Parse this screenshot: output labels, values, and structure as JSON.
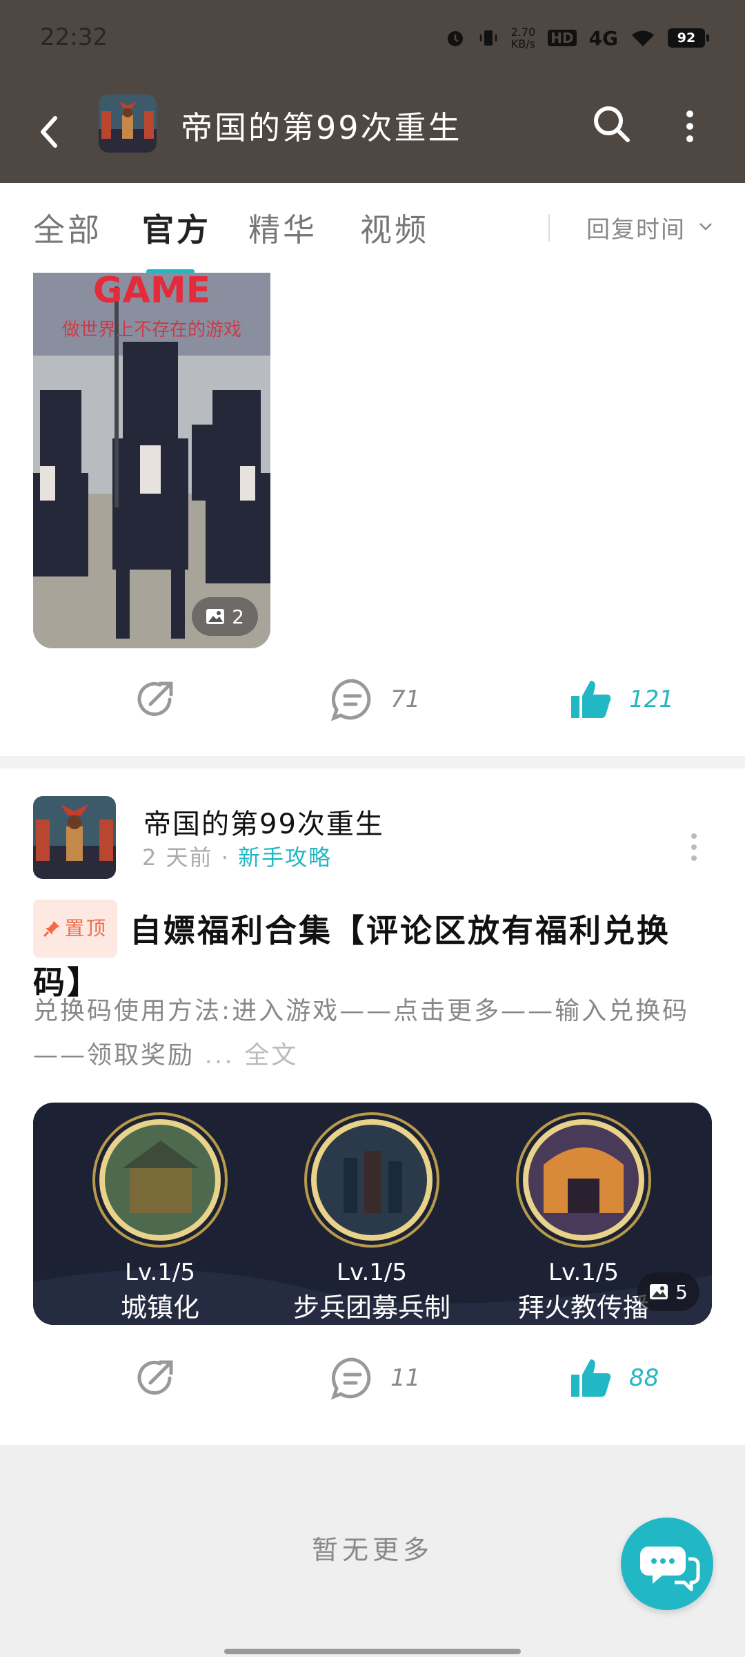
{
  "status_bar": {
    "time": "22:32",
    "net_speed_value": "2.70",
    "net_speed_unit": "KB/s",
    "hd_label": "HD",
    "network": "4G",
    "battery": "92"
  },
  "header": {
    "title": "帝国的第99次重生",
    "back_icon": "back-arrow-icon",
    "search_icon": "search-icon",
    "more_icon": "more-vertical-icon"
  },
  "tabs": {
    "items": [
      "全部",
      "官方",
      "精华",
      "视频"
    ],
    "active": "官方",
    "sort_label": "回复时间"
  },
  "post1": {
    "image_caption_title": "GAME",
    "image_caption_sub": "做世界上不存在的游戏",
    "image_count": "2",
    "share_icon": "share-icon",
    "comments": "71",
    "likes": "121"
  },
  "post2": {
    "author": "帝国的第99次重生",
    "time_ago": "2 天前",
    "dot": "·",
    "category": "新手攻略",
    "pin_label": "置顶",
    "title": "自嫖福利合集【评论区放有福利兑换码】",
    "excerpt": "兑换码使用方法:进入游戏——点击更多——输入兑换码——领取奖励",
    "ellipsis": "...",
    "read_more": "全文",
    "skills": [
      {
        "level": "Lv.1/5",
        "name": "城镇化"
      },
      {
        "level": "Lv.1/5",
        "name": "步兵团募兵制"
      },
      {
        "level": "Lv.1/5",
        "name": "拜火教传播"
      }
    ],
    "image_count": "5",
    "comments": "11",
    "likes": "88"
  },
  "footer": {
    "no_more": "暂无更多"
  },
  "colors": {
    "accent": "#22b7c4",
    "header_bg": "#4f4741",
    "pin": "#f06a4a"
  }
}
